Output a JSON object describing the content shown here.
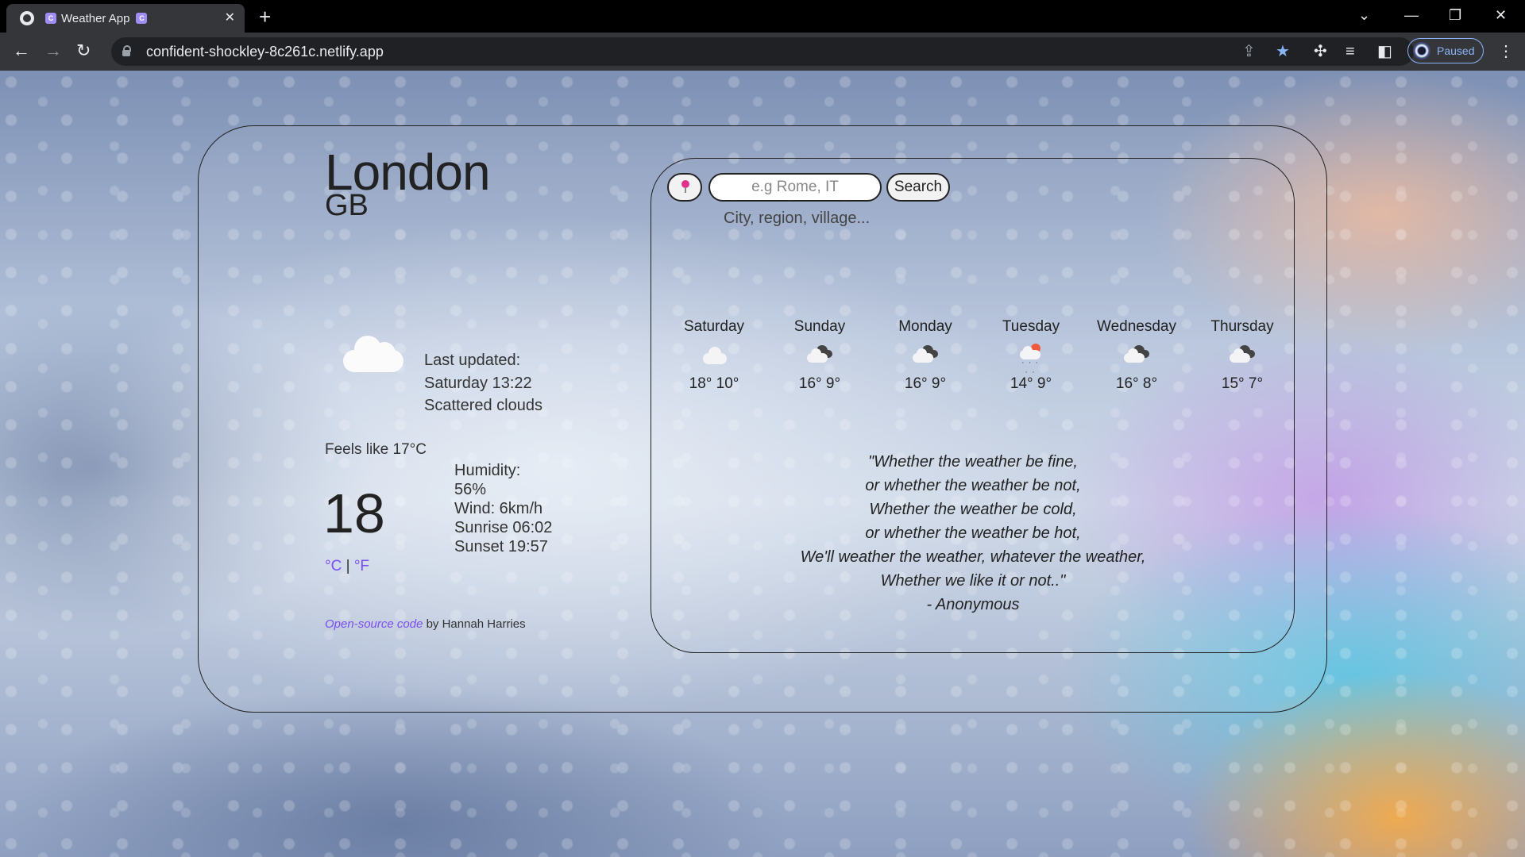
{
  "browser": {
    "tab_title": "Weather App",
    "url": "confident-shockley-8c261c.netlify.app",
    "profile_status": "Paused"
  },
  "app": {
    "city": "London",
    "country": "GB",
    "current_icon": "cloud-icon",
    "last_updated_label": "Last updated:",
    "last_updated": "Saturday 13:22",
    "description": "Scattered clouds",
    "feels_like": "Feels like 17°C",
    "temperature": "18",
    "unit_celsius": "°C",
    "unit_separator": "|",
    "unit_fahrenheit": "°F",
    "humidity_label": "Humidity:",
    "humidity": "56%",
    "wind": "Wind: 6km/h",
    "sunrise": "Sunrise 06:02",
    "sunset": "Sunset 19:57",
    "footer_link": "Open-source code",
    "footer_text": "by Hannah Harries"
  },
  "search": {
    "placeholder": "e.g Rome, IT",
    "button": "Search",
    "hint": "City, region, village..."
  },
  "forecast": [
    {
      "day": "Saturday",
      "icon": "cloud-icon",
      "temps": "18° 10°"
    },
    {
      "day": "Sunday",
      "icon": "broken-clouds-icon",
      "temps": "16° 9°"
    },
    {
      "day": "Monday",
      "icon": "broken-clouds-icon",
      "temps": "16° 9°"
    },
    {
      "day": "Tuesday",
      "icon": "sun-rain-icon",
      "temps": "14° 9°"
    },
    {
      "day": "Wednesday",
      "icon": "broken-clouds-icon",
      "temps": "16° 8°"
    },
    {
      "day": "Thursday",
      "icon": "broken-clouds-icon",
      "temps": "15° 7°"
    }
  ],
  "quote": {
    "lines": [
      "\"Whether the weather be fine,",
      "or whether the weather be not,",
      "Whether the weather be cold,",
      "or whether the weather be hot,",
      "We'll weather the weather, whatever the weather,",
      "Whether we like it or not..\"",
      "- Anonymous"
    ]
  }
}
